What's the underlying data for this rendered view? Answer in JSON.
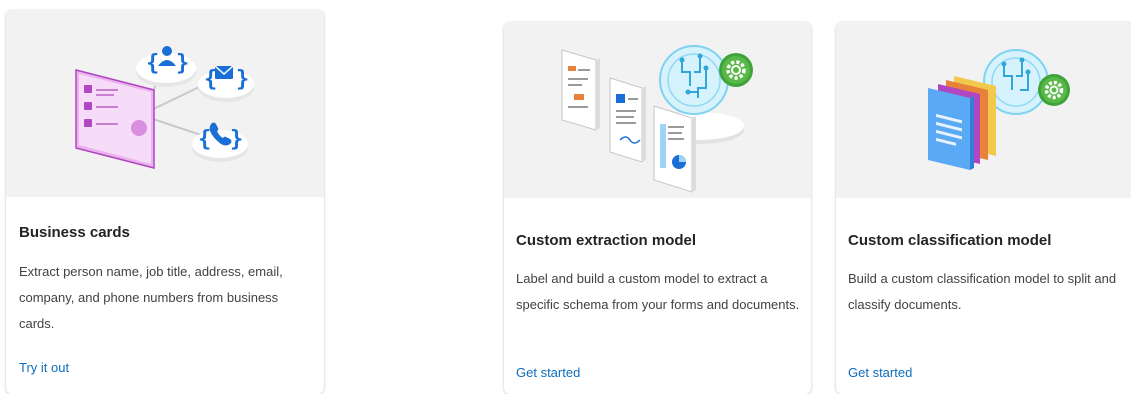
{
  "cards": [
    {
      "title": "Business cards",
      "description": "Extract person name, job title, address, email, company, and phone numbers from business cards.",
      "link_label": "Try it out",
      "illustration": "business-card-illustration"
    },
    {
      "title": "Custom extraction model",
      "description": "Label and build a custom model to extract a specific schema from your forms and documents.",
      "link_label": "Get started",
      "illustration": "custom-extraction-illustration"
    },
    {
      "title": "Custom classification model",
      "description": "Build a custom classification model to split and classify documents.",
      "link_label": "Get started",
      "illustration": "custom-classification-illustration"
    }
  ],
  "colors": {
    "link": "#0f6cbd",
    "illustration_bg": "#f2f2f2",
    "accent_purple": "#b146c2",
    "accent_blue": "#1a6fd6",
    "accent_green": "#3fa33c",
    "accent_orange": "#e8813a"
  }
}
